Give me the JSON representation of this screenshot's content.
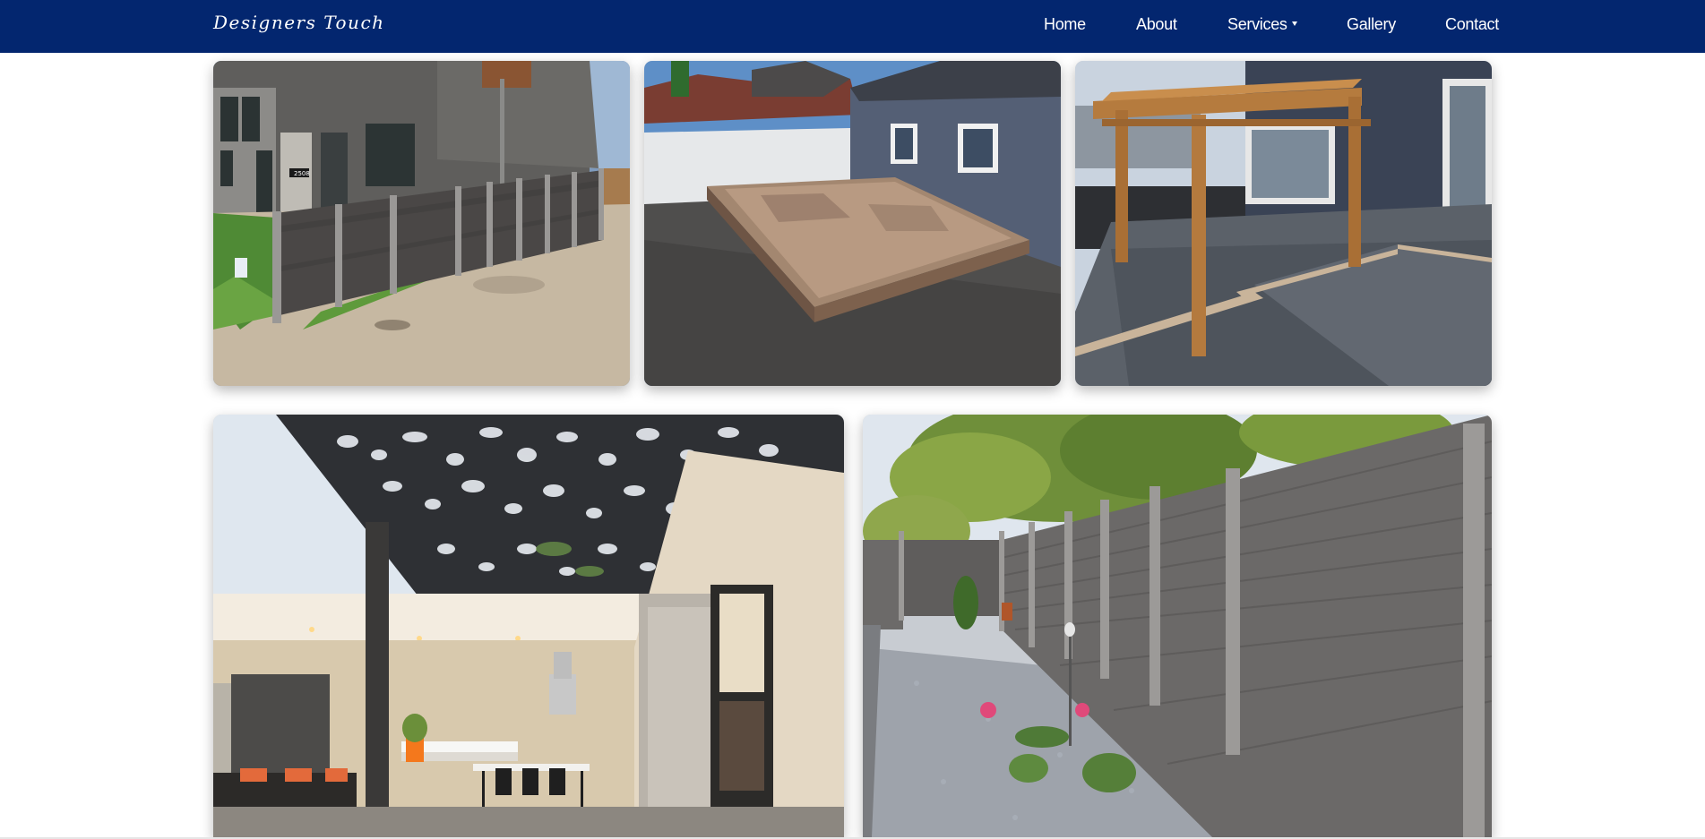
{
  "brand": {
    "name": "Designers Touch"
  },
  "nav": {
    "home": "Home",
    "about": "About",
    "services": "Services",
    "gallery": "Gallery",
    "contact": "Contact"
  },
  "colors": {
    "navbar": "#03266f",
    "nav_text": "#ffffff",
    "page_background": "#ffffff"
  },
  "icons": {
    "services_dropdown": "caret-down-icon"
  },
  "gallery": {
    "images": [
      {
        "subject": "composite-fence-beside-house"
      },
      {
        "subject": "floating-deck-on-gravel"
      },
      {
        "subject": "deck-with-wooden-pergola"
      },
      {
        "subject": "patio-with-laser-cut-metal-canopy"
      },
      {
        "subject": "grey-privacy-fence-with-garden"
      }
    ]
  },
  "house_number": "2508"
}
